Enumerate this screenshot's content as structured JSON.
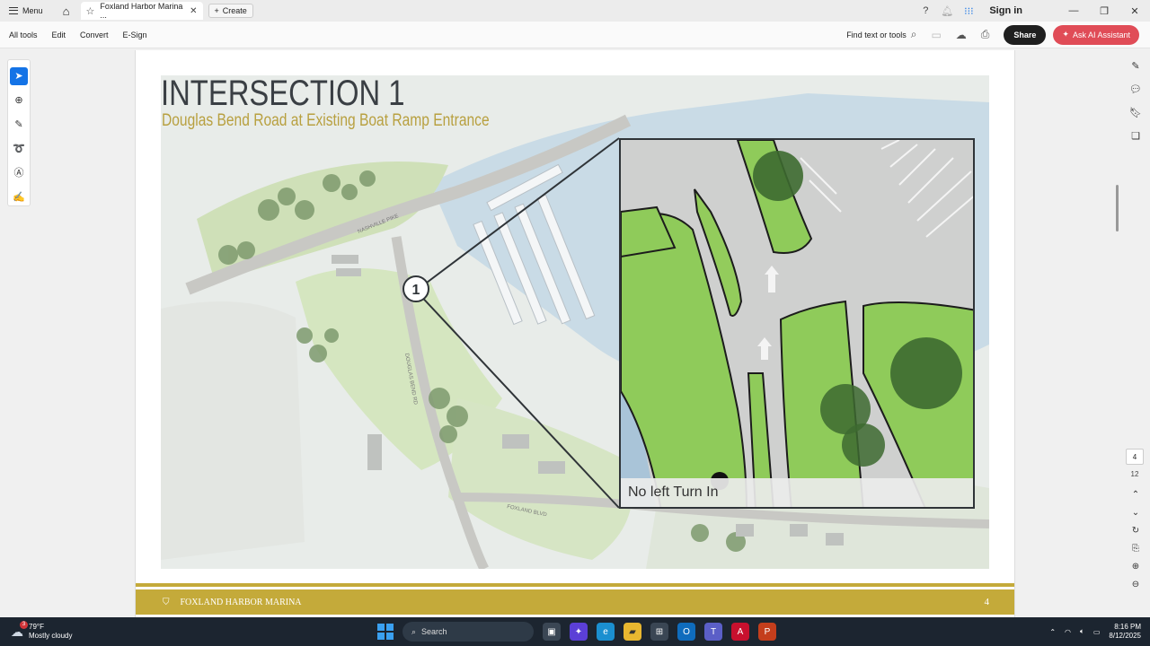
{
  "titlebar": {
    "menu_label": "Menu",
    "tab_title": "Foxland Harbor Marina ...",
    "create_label": "Create",
    "sign_in": "Sign in",
    "icons": [
      "help-icon",
      "notification-icon",
      "apps-grid-icon"
    ]
  },
  "toolbar": {
    "items": [
      "All tools",
      "Edit",
      "Convert",
      "E-Sign"
    ],
    "find_label": "Find text or tools",
    "share_label": "Share",
    "ai_label": "Ask AI Assistant"
  },
  "document": {
    "title": "INTERSECTION 1",
    "subtitle": "Douglas Bend Road at Existing Boat Ramp Entrance",
    "marker_label": "1",
    "road_labels": [
      "NASHVILLE PIKE",
      "DOUGLAS BEND RD",
      "FOXLAND BLVD"
    ],
    "inset_caption": "No left Turn In",
    "footer_text": "FOXLAND HARBOR MARINA",
    "footer_mark": "4"
  },
  "page_nav": {
    "current": "4",
    "total": "12"
  },
  "taskbar": {
    "weather_badge": "3",
    "temperature": "79°F",
    "condition": "Mostly cloudy",
    "search_placeholder": "Search",
    "time": "8:16 PM",
    "date": "8/12/2025"
  },
  "colors": {
    "accent_gold": "#c4aa3a",
    "ai_button": "#e04c57",
    "share_button": "#1f1f1f",
    "select_tool": "#1473e6"
  }
}
